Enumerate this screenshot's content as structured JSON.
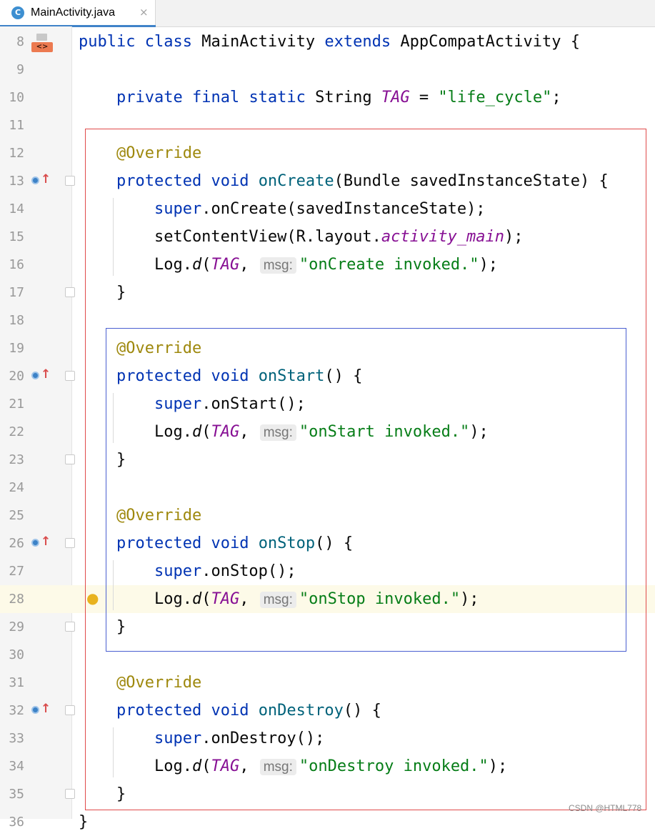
{
  "tab": {
    "icon_letter": "C",
    "title": "MainActivity.java",
    "close_glyph": "×"
  },
  "lines": [
    {
      "n": "8",
      "tokens": [
        [
          "kw",
          "public"
        ],
        [
          "p",
          " "
        ],
        [
          "kw",
          "class"
        ],
        [
          "p",
          " MainActivity "
        ],
        [
          "kw",
          "extends"
        ],
        [
          "p",
          " AppCompatActivity {"
        ]
      ]
    },
    {
      "n": "9",
      "tokens": []
    },
    {
      "n": "10",
      "tokens": [
        [
          "p",
          "    "
        ],
        [
          "kw",
          "private"
        ],
        [
          "p",
          " "
        ],
        [
          "kw",
          "final"
        ],
        [
          "p",
          " "
        ],
        [
          "kw",
          "static"
        ],
        [
          "p",
          " String "
        ],
        [
          "fld",
          "TAG"
        ],
        [
          "p",
          " = "
        ],
        [
          "str",
          "\"life_cycle\""
        ],
        [
          "p",
          ";"
        ]
      ]
    },
    {
      "n": "11",
      "tokens": []
    },
    {
      "n": "12",
      "tokens": [
        [
          "p",
          "    "
        ],
        [
          "ann",
          "@Override"
        ]
      ]
    },
    {
      "n": "13",
      "tokens": [
        [
          "p",
          "    "
        ],
        [
          "kw",
          "protected"
        ],
        [
          "p",
          " "
        ],
        [
          "kw",
          "void"
        ],
        [
          "p",
          " "
        ],
        [
          "fn",
          "onCreate"
        ],
        [
          "p",
          "(Bundle savedInstanceState) {"
        ]
      ]
    },
    {
      "n": "14",
      "tokens": [
        [
          "p",
          "        "
        ],
        [
          "kw",
          "super"
        ],
        [
          "p",
          ".onCreate(savedInstanceState);"
        ]
      ]
    },
    {
      "n": "15",
      "tokens": [
        [
          "p",
          "        setContentView(R.layout."
        ],
        [
          "fld",
          "activity_main"
        ],
        [
          "p",
          ");"
        ]
      ]
    },
    {
      "n": "16",
      "tokens": [
        [
          "p",
          "        Log."
        ],
        [
          "st",
          "d"
        ],
        [
          "p",
          "("
        ],
        [
          "fld",
          "TAG"
        ],
        [
          "p",
          ", "
        ],
        [
          "hint",
          "msg:"
        ],
        [
          "str",
          "\"onCreate invoked.\""
        ],
        [
          "p",
          ");"
        ]
      ]
    },
    {
      "n": "17",
      "tokens": [
        [
          "p",
          "    }"
        ]
      ]
    },
    {
      "n": "18",
      "tokens": []
    },
    {
      "n": "19",
      "tokens": [
        [
          "p",
          "    "
        ],
        [
          "ann",
          "@Override"
        ]
      ]
    },
    {
      "n": "20",
      "tokens": [
        [
          "p",
          "    "
        ],
        [
          "kw",
          "protected"
        ],
        [
          "p",
          " "
        ],
        [
          "kw",
          "void"
        ],
        [
          "p",
          " "
        ],
        [
          "fn",
          "onStart"
        ],
        [
          "p",
          "() {"
        ]
      ]
    },
    {
      "n": "21",
      "tokens": [
        [
          "p",
          "        "
        ],
        [
          "kw",
          "super"
        ],
        [
          "p",
          ".onStart();"
        ]
      ]
    },
    {
      "n": "22",
      "tokens": [
        [
          "p",
          "        Log."
        ],
        [
          "st",
          "d"
        ],
        [
          "p",
          "("
        ],
        [
          "fld",
          "TAG"
        ],
        [
          "p",
          ", "
        ],
        [
          "hint",
          "msg:"
        ],
        [
          "str",
          "\"onStart invoked.\""
        ],
        [
          "p",
          ");"
        ]
      ]
    },
    {
      "n": "23",
      "tokens": [
        [
          "p",
          "    }"
        ]
      ]
    },
    {
      "n": "24",
      "tokens": []
    },
    {
      "n": "25",
      "tokens": [
        [
          "p",
          "    "
        ],
        [
          "ann",
          "@Override"
        ]
      ]
    },
    {
      "n": "26",
      "tokens": [
        [
          "p",
          "    "
        ],
        [
          "kw",
          "protected"
        ],
        [
          "p",
          " "
        ],
        [
          "kw",
          "void"
        ],
        [
          "p",
          " "
        ],
        [
          "fn",
          "onStop"
        ],
        [
          "p",
          "() {"
        ]
      ]
    },
    {
      "n": "27",
      "tokens": [
        [
          "p",
          "        "
        ],
        [
          "kw",
          "super"
        ],
        [
          "p",
          ".onStop();"
        ]
      ]
    },
    {
      "n": "28",
      "tokens": [
        [
          "p",
          "        Log."
        ],
        [
          "st",
          "d"
        ],
        [
          "p",
          "("
        ],
        [
          "fld",
          "TAG"
        ],
        [
          "p",
          ", "
        ],
        [
          "hint",
          "msg:"
        ],
        [
          "str",
          "\"onStop invoked.\""
        ],
        [
          "p",
          ");"
        ]
      ]
    },
    {
      "n": "29",
      "tokens": [
        [
          "p",
          "    }"
        ]
      ]
    },
    {
      "n": "30",
      "tokens": []
    },
    {
      "n": "31",
      "tokens": [
        [
          "p",
          "    "
        ],
        [
          "ann",
          "@Override"
        ]
      ]
    },
    {
      "n": "32",
      "tokens": [
        [
          "p",
          "    "
        ],
        [
          "kw",
          "protected"
        ],
        [
          "p",
          " "
        ],
        [
          "kw",
          "void"
        ],
        [
          "p",
          " "
        ],
        [
          "fn",
          "onDestroy"
        ],
        [
          "p",
          "() {"
        ]
      ]
    },
    {
      "n": "33",
      "tokens": [
        [
          "p",
          "        "
        ],
        [
          "kw",
          "super"
        ],
        [
          "p",
          ".onDestroy();"
        ]
      ]
    },
    {
      "n": "34",
      "tokens": [
        [
          "p",
          "        Log."
        ],
        [
          "st",
          "d"
        ],
        [
          "p",
          "("
        ],
        [
          "fld",
          "TAG"
        ],
        [
          "p",
          ", "
        ],
        [
          "hint",
          "msg:"
        ],
        [
          "str",
          "\"onDestroy invoked.\""
        ],
        [
          "p",
          ");"
        ]
      ]
    },
    {
      "n": "35",
      "tokens": [
        [
          "p",
          "    }"
        ]
      ]
    },
    {
      "n": "36",
      "tokens": [
        [
          "p",
          "}"
        ]
      ]
    }
  ],
  "gutter": {
    "class_icon": "xml-layout-icon",
    "class_icon_label": "<>",
    "override_lines": [
      "13",
      "20",
      "26",
      "32"
    ],
    "override_icon": "override-method-icon",
    "fold_lines": [
      "13",
      "17",
      "20",
      "23",
      "26",
      "29",
      "32",
      "35"
    ],
    "fold_icon": "fold-marker-icon",
    "highlight_line": "28",
    "bulb_line": "28",
    "bulb_icon": "lightbulb-icon"
  },
  "annotations": {
    "red_box_color": "#e04a4a",
    "blue_box_color": "#4a5fd0"
  },
  "watermark": "CSDN @HTML778"
}
